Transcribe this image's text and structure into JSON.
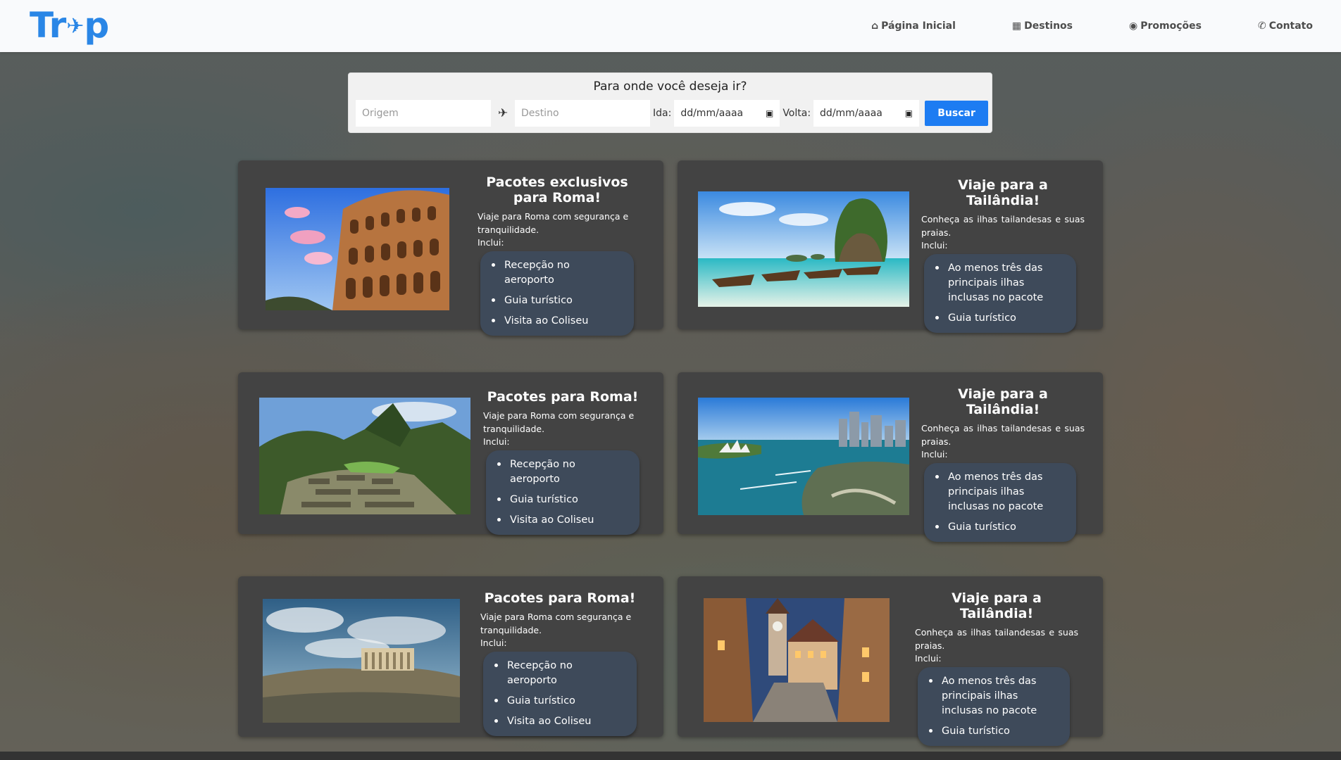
{
  "header": {
    "logo": "Trip",
    "nav": [
      {
        "icon": "home-icon",
        "glyph": "⌂",
        "label": "Página Inicial"
      },
      {
        "icon": "map-icon",
        "glyph": "▦",
        "label": "Destinos"
      },
      {
        "icon": "fire-icon",
        "glyph": "◉",
        "label": "Promoções"
      },
      {
        "icon": "phone-icon",
        "glyph": "✆",
        "label": "Contato"
      }
    ]
  },
  "search": {
    "title": "Para onde você deseja ir?",
    "origin_placeholder": "Origem",
    "destination_placeholder": "Destino",
    "ida_label": "Ida:",
    "ida_value": "dd/mm/aaaa",
    "volta_label": "Volta:",
    "volta_value": "dd/mm/aaaa",
    "button": "Buscar"
  },
  "cards": [
    {
      "image": "colosseum-photo",
      "title": "Pacotes exclusivos para Roma!",
      "desc": "Viaje para Roma com segurança e tranquilidade.",
      "includes_label": "Inclui:",
      "items": [
        "Recepção no aeroporto",
        "Guia turístico",
        "Visita ao Coliseu"
      ]
    },
    {
      "image": "thailand-beach-photo",
      "title": "Viaje para a Tailândia!",
      "desc": "Conheça as ilhas tailandesas e suas praias.",
      "includes_label": "Inclui:",
      "items": [
        "Ao menos três das principais ilhas inclusas no pacote",
        "Guia turístico"
      ]
    },
    {
      "image": "machu-picchu-photo",
      "title": "Pacotes para Roma!",
      "desc": "Viaje para Roma com segurança e tranquilidade.",
      "includes_label": "Inclui:",
      "items": [
        "Recepção no aeroporto",
        "Guia turístico",
        "Visita ao Coliseu"
      ]
    },
    {
      "image": "sydney-harbour-photo",
      "title": "Viaje para a Tailândia!",
      "desc": "Conheça as ilhas tailandesas e suas praias.",
      "includes_label": "Inclui:",
      "items": [
        "Ao menos três das principais ilhas inclusas no pacote",
        "Guia turístico"
      ]
    },
    {
      "image": "acropolis-photo",
      "title": "Pacotes para Roma!",
      "desc": "Viaje para Roma com segurança e tranquilidade.",
      "includes_label": "Inclui:",
      "items": [
        "Recepção no aeroporto",
        "Guia turístico",
        "Visita ao Coliseu"
      ]
    },
    {
      "image": "rothenburg-street-photo",
      "title": "Viaje para a Tailândia!",
      "desc": "Conheça as ilhas tailandesas e suas praias.",
      "includes_label": "Inclui:",
      "items": [
        "Ao menos três das principais ilhas inclusas no pacote",
        "Guia turístico"
      ]
    }
  ]
}
